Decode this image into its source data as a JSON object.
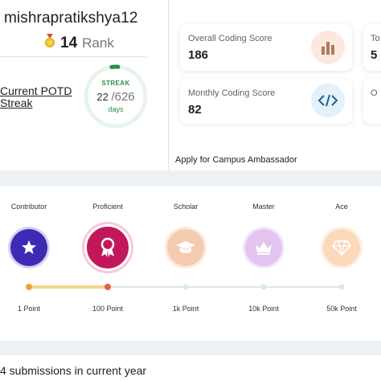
{
  "profile": {
    "username": "mishrapratikshya12",
    "rank_number": "14",
    "rank_word": "Rank",
    "potd_label": "Current POTD Streak",
    "streak": {
      "label": "STREAK",
      "current": "22",
      "separator": "/",
      "total": "626",
      "unit": "days",
      "progress": 0.035
    }
  },
  "stats": {
    "overall": {
      "title": "Overall Coding Score",
      "value": "186",
      "icon": "bar-chart-icon"
    },
    "monthly": {
      "title": "Monthly Coding Score",
      "value": "82",
      "icon": "code-icon"
    },
    "partial_top": {
      "title": "To",
      "value": "5"
    },
    "partial_bottom": {
      "title": "O",
      "value": ""
    },
    "apply_link": "Apply for Campus Ambassador"
  },
  "badges": [
    {
      "name": "Contributor",
      "points": "1 Point",
      "icon": "star-badge-icon",
      "color": "#3d2bb5",
      "achieved": true
    },
    {
      "name": "Proficient",
      "points": "100 Point",
      "icon": "ribbon-badge-icon",
      "color": "#c2185b",
      "achieved": true
    },
    {
      "name": "Scholar",
      "points": "1k Point",
      "icon": "graduation-cap-icon",
      "color": "#f5cbb0",
      "achieved": false
    },
    {
      "name": "Master",
      "points": "10k Point",
      "icon": "crown-icon",
      "color": "#e2c4f0",
      "achieved": false
    },
    {
      "name": "Ace",
      "points": "50k Point",
      "icon": "diamond-icon",
      "color": "#fbd9b9",
      "achieved": false
    }
  ],
  "footer": {
    "submissions_text": "4 submissions in current year"
  },
  "colors": {
    "green": "#2f8d46",
    "progress_orange": "#f0a03c",
    "progress_fill": "#f4d58a",
    "track": "#d9e8ea"
  }
}
